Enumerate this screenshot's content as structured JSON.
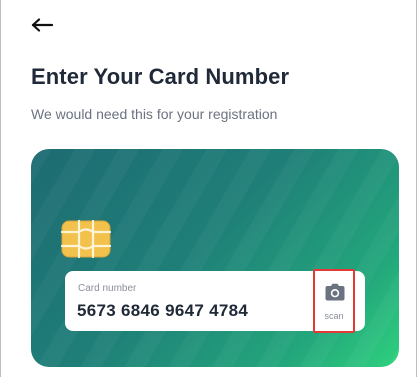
{
  "header": {
    "back_icon": "arrow-left-icon",
    "title": "Enter Your Card Number",
    "subtitle": "We would need this for your registration"
  },
  "card": {
    "chip_icon": "card-chip-icon",
    "gradient_start": "#1d6b72",
    "gradient_end": "#2fd17e",
    "chip_color": "#f2c24d",
    "card_number_field": {
      "label": "Card number",
      "value": "5673 6846 9647 4784"
    },
    "scan": {
      "icon": "camera-icon",
      "label": "scan",
      "highlight_color": "#e53935"
    }
  }
}
